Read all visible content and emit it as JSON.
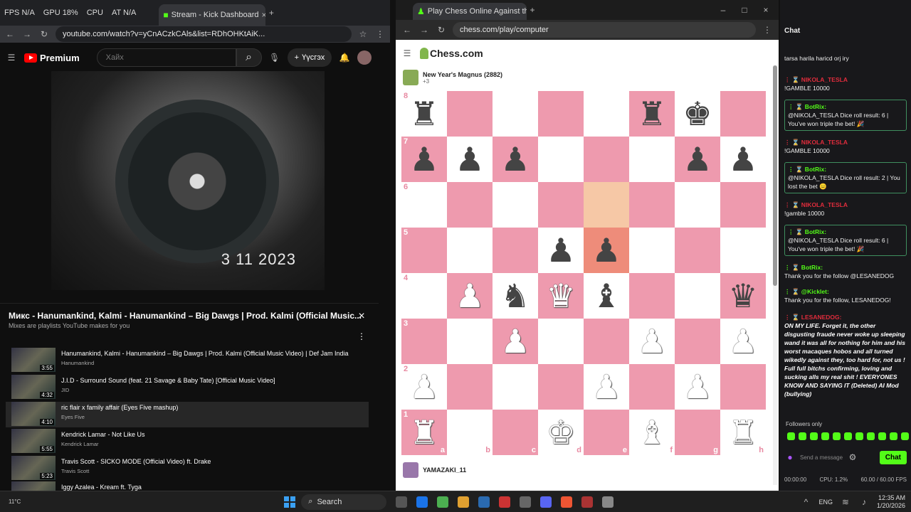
{
  "left": {
    "tabs": [
      "FPS N/A",
      "GPU 18%",
      "CPU",
      "AT N/A",
      "",
      "Stream - Kick Dashboard"
    ],
    "url": "youtube.com/watch?v=yCnACzkCAls&list=RDhOHKtAiK...",
    "youtube": {
      "logo": "Premium",
      "search_placeholder": "Хайх",
      "create_label": "Үүсгэх",
      "notif_count": "9+"
    },
    "video_date": "3 11 2023",
    "playlist": {
      "title": "Микс - Hanumankind, Kalmi - Hanumankind – Big Dawgs | Prod. Kalmi (Official Music...",
      "subtitle": "Mixes are playlists YouTube makes for you",
      "items": [
        {
          "title": "Hanumankind, Kalmi - Hanumankind – Big Dawgs | Prod. Kalmi (Official Music Video) | Def Jam India",
          "author": "Hanumankind",
          "dur": "3:55"
        },
        {
          "title": "J.I.D - Surround Sound (feat. 21 Savage & Baby Tate) [Official Music Video]",
          "author": "JID",
          "dur": "4:32"
        },
        {
          "title": "ric flair x family affair (Eyes Five mashup)",
          "author": "Eyes Five",
          "dur": "4:10"
        },
        {
          "title": "Kendrick Lamar - Not Like Us",
          "author": "Kendrick Lamar",
          "dur": "5:55"
        },
        {
          "title": "Travis Scott - SICKO MODE (Official Video) ft. Drake",
          "author": "Travis Scott",
          "dur": "5:23"
        },
        {
          "title": "Iggy Azalea - Kream ft. Tyga",
          "author": "",
          "dur": ""
        }
      ]
    }
  },
  "center": {
    "tab_title": "Play Chess Online Against the C",
    "url": "chess.com/play/computer",
    "logo": "Chess.com",
    "top_player": {
      "name": "New Year's Magnus (2882)",
      "captured": "+3"
    },
    "bottom_player": {
      "name": "YAMAZAKI_11"
    },
    "ranks": [
      "8",
      "7",
      "6",
      "5",
      "4",
      "3",
      "2",
      "1"
    ],
    "files": [
      "a",
      "b",
      "c",
      "d",
      "e",
      "f",
      "g",
      "h"
    ],
    "board": [
      [
        "r",
        "",
        "",
        "",
        "",
        "r",
        "k",
        ""
      ],
      [
        "p",
        "p",
        "p",
        "",
        "",
        "",
        "p",
        "p"
      ],
      [
        "",
        "",
        "",
        "",
        "",
        "",
        "",
        ""
      ],
      [
        "",
        "",
        "",
        "p",
        "p",
        "",
        "",
        ""
      ],
      [
        "",
        "P",
        "n",
        "Q",
        "b",
        "",
        "",
        "q"
      ],
      [
        "",
        "",
        "P",
        "",
        "",
        "P",
        "",
        "P"
      ],
      [
        "P",
        "",
        "",
        "",
        "P",
        "",
        "P",
        ""
      ],
      [
        "R",
        "",
        "",
        "K",
        "",
        "B",
        "",
        "R"
      ]
    ],
    "highlight": {
      "from": [
        2,
        4
      ],
      "to": [
        3,
        4
      ]
    }
  },
  "chat": {
    "title": "Chat",
    "messages": [
      {
        "user": "",
        "text": "tarsa harila haricd orj iry",
        "bot": false
      },
      {
        "user": "NIKOLA_TESLA",
        "text": "!GAMBLE 10000",
        "bot": false
      },
      {
        "user": "BotRix:",
        "text": "@NIKOLA_TESLA Dice roll result: 6 | You've won triple the bet! 🎉",
        "bot": true
      },
      {
        "user": "NIKOLA_TESLA",
        "text": "!GAMBLE 10000",
        "bot": false
      },
      {
        "user": "BotRix:",
        "text": "@NIKOLA_TESLA Dice roll result: 2 | You lost the bet 😑",
        "bot": true
      },
      {
        "user": "NIKOLA_TESLA",
        "text": "!gamble 10000",
        "bot": false
      },
      {
        "user": "BotRix:",
        "text": "@NIKOLA_TESLA Dice roll result: 6 | You've won triple the bet! 🎉",
        "bot": true
      },
      {
        "user": "BotRix:",
        "text": "Thank you for the follow @LESANEDOG",
        "bot": false
      },
      {
        "user": "@Kicklet:",
        "text": "Thank you for the follow, LESANEDOG!",
        "bot": false
      },
      {
        "user": "LESANEDOG:",
        "text": "ON MY LIFE. Forget it, the other disgusting fraude never woke up sleeping wand it was all for nothing for him and his worst macaques hobos and all turned wikedly against they, too hard for, not us ! Full full bitchs confirming, loving and sucking alls my real shit ! EVERYONES KNOW AND SAYING IT (Deleted) AI Mod (bullying)",
        "bot": false
      }
    ],
    "followers_only": "Followers only",
    "input_placeholder": "Send a message",
    "send_label": "Chat"
  },
  "status": {
    "time": "00:00:00",
    "cpu": "CPU: 1.2%",
    "fps": "60.00 / 60.00 FPS"
  },
  "taskbar": {
    "search": "Search",
    "weather": "11°C",
    "lang": "ENG",
    "clock_time": "12:35 AM",
    "clock_date": "1/20/2026"
  }
}
